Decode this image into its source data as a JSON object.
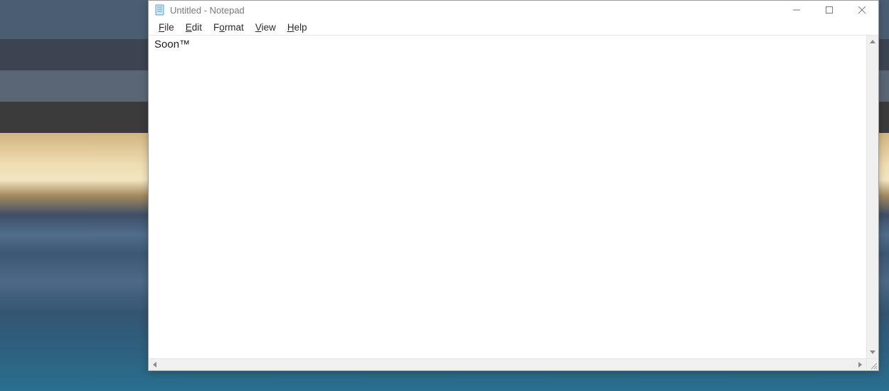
{
  "window": {
    "title": "Untitled - Notepad"
  },
  "menubar": {
    "file": "File",
    "edit": "Edit",
    "format": "Format",
    "view": "View",
    "help": "Help"
  },
  "document": {
    "content": "Soon™"
  }
}
